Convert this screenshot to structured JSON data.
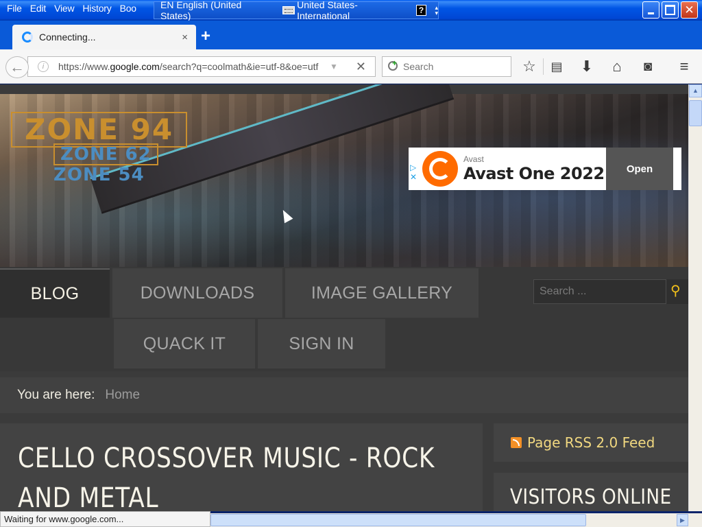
{
  "menu": [
    "File",
    "Edit",
    "View",
    "History",
    "Boo"
  ],
  "langbar": {
    "language": "EN English (United States)",
    "layout": "United States-International",
    "help": "?"
  },
  "tab": {
    "title": "Connecting...",
    "close": "×"
  },
  "newtab": "+",
  "navbar": {
    "url_prefix": "https://www.",
    "url_domain": "google.com",
    "url_rest": "/search?q=coolmath&ie=utf-8&oe=utf",
    "search_placeholder": "Search"
  },
  "ad": {
    "brand": "Avast",
    "title": "Avast One 2022",
    "cta": "Open"
  },
  "site": {
    "logo_main": "ZONE 94",
    "logo_sub1": "ZONE 62",
    "logo_sub2": "ZONE 54",
    "nav": [
      {
        "label": "BLOG"
      },
      {
        "label": "DOWNLOADS"
      },
      {
        "label": "IMAGE GALLERY"
      },
      {
        "label": "QUACK IT"
      },
      {
        "label": "SIGN IN"
      }
    ],
    "search_placeholder": "Search ...",
    "breadcrumb_label": "You are here:",
    "breadcrumb_home": "Home",
    "article_title": "CELLO CROSSOVER MUSIC - ROCK AND METAL",
    "rss_label": "Page RSS 2.0 Feed",
    "visitors_heading": "VISITORS ONLINE"
  },
  "status": "Waiting for www.google.com..."
}
